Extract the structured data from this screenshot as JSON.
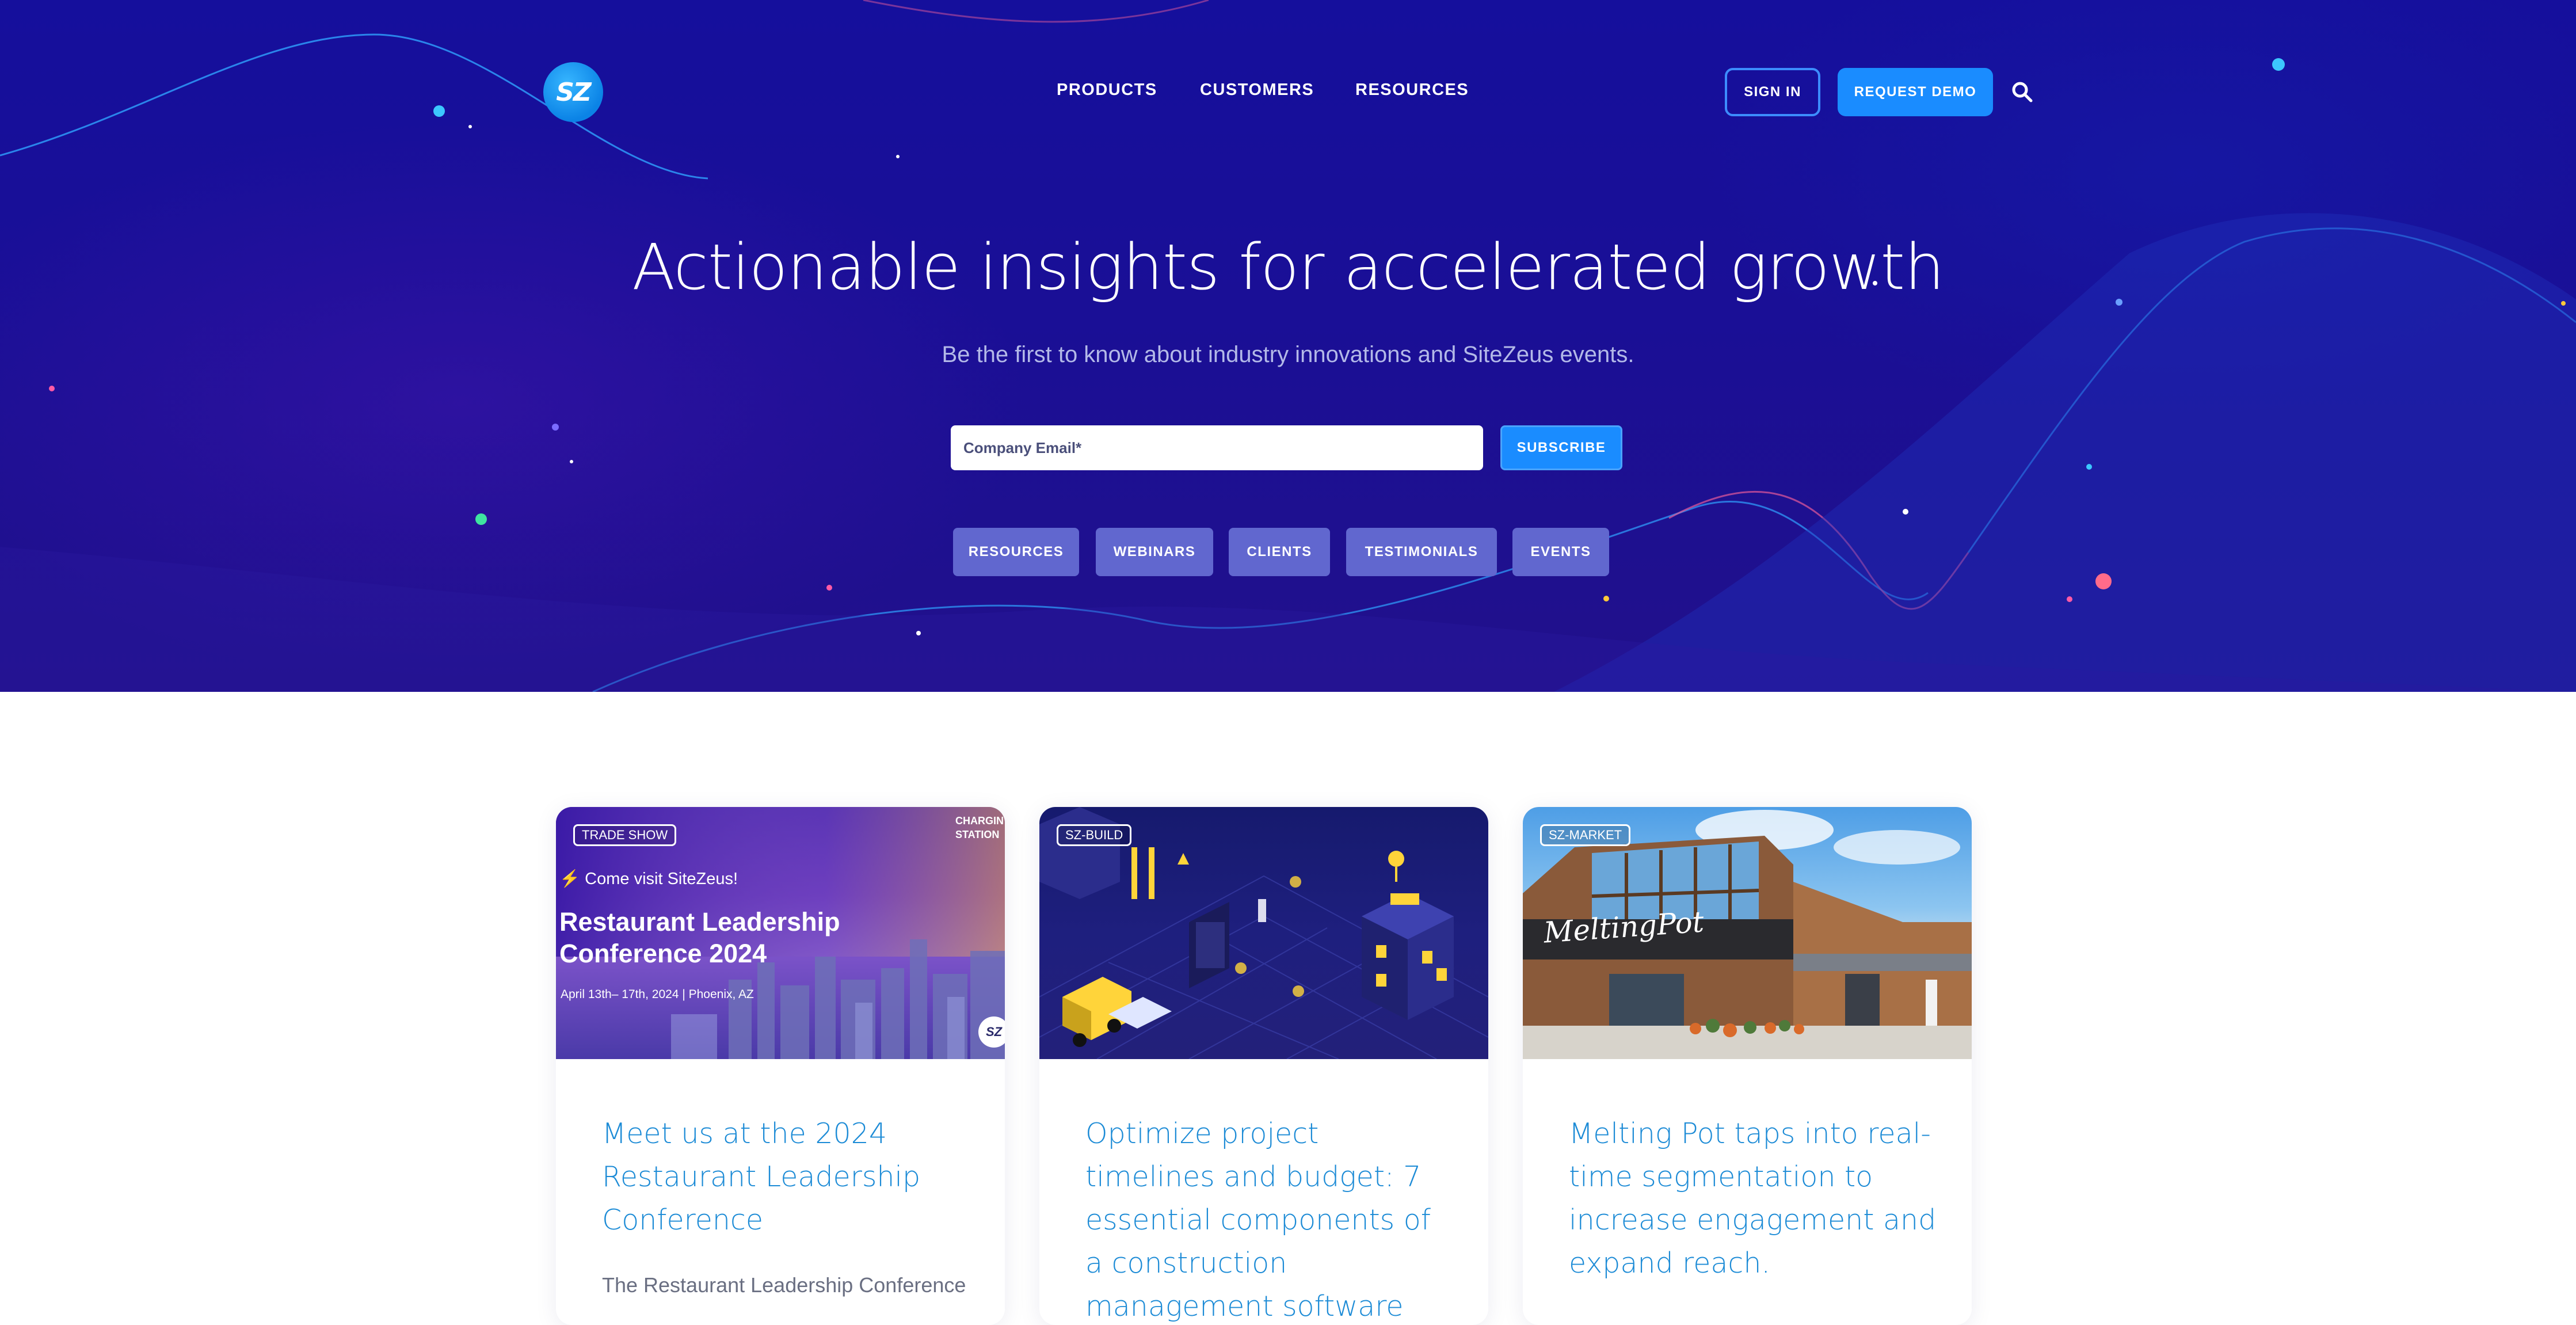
{
  "nav": {
    "logo_text": "SZ",
    "links": [
      "PRODUCTS",
      "CUSTOMERS",
      "RESOURCES"
    ],
    "sign_in": "SIGN IN",
    "request_demo": "REQUEST DEMO",
    "search_icon": "search-icon"
  },
  "hero": {
    "title": "Actionable insights for accelerated growth",
    "subtitle": "Be the first to know about industry innovations and SiteZeus events.",
    "email_placeholder": "Company Email*",
    "subscribe": "SUBSCRIBE",
    "categories": [
      "RESOURCES",
      "WEBINARS",
      "CLIENTS",
      "TESTIMONIALS",
      "EVENTS"
    ]
  },
  "cards": [
    {
      "tag": "TRADE SHOW",
      "title": "Meet us at the 2024 Restaurant Leadership Conference",
      "excerpt": "The Restaurant Leadership Conference",
      "image": {
        "kicker": "Come visit SiteZeus!",
        "headline_line1": "Restaurant Leadership",
        "headline_line2": "Conference 2024",
        "details": "April 13th– 17th, 2024 | Phoenix, AZ",
        "corner_line1": "CHARGIN",
        "corner_line2": "STATION",
        "badge": "SZ"
      }
    },
    {
      "tag": "SZ-BUILD",
      "title": "Optimize project timelines and budget: 7 essential components of a construction management software"
    },
    {
      "tag": "SZ-MARKET",
      "title": "Melting Pot taps into real-time segmentation to increase engagement and expand reach.",
      "image": {
        "sign": "MeltingPot"
      }
    }
  ],
  "colors": {
    "hero_bg": "#1a0f96",
    "accent_blue": "#1a8cff",
    "pill_bg": "#6167cf",
    "card_title": "#1c8bd6"
  }
}
